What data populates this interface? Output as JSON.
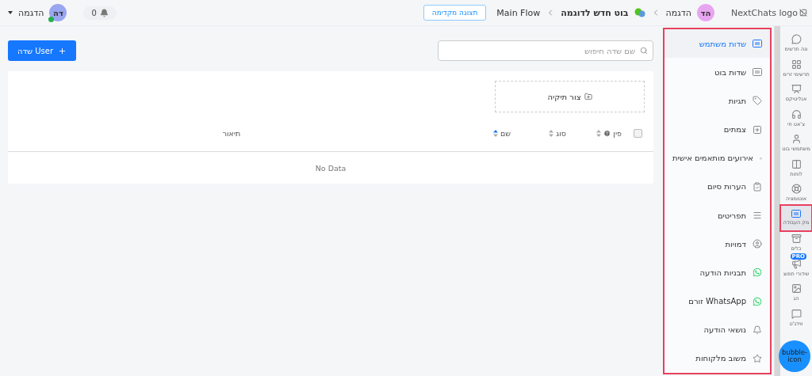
{
  "header": {
    "logo_alt": "NextChats logo",
    "workspace": {
      "initials": "הד",
      "name": "הדגמה"
    },
    "breadcrumbs": [
      {
        "label": "בוט חדש לדוגמה",
        "kind": "bot"
      },
      {
        "label": "Main Flow",
        "kind": "plain"
      }
    ],
    "preview_button": "תצוגה מקדימה",
    "notifications": "0",
    "user": {
      "initials": "דה",
      "name": "הדגמה",
      "online": true
    }
  },
  "rail": [
    {
      "label": "ונה תרשימ",
      "selected": false
    },
    {
      "label": "תרשימי זרימ",
      "selected": false
    },
    {
      "label": "אנליטיקס",
      "selected": false
    },
    {
      "label": "צ'אט חי",
      "selected": false
    },
    {
      "label": "משתמשי בוט",
      "selected": false
    },
    {
      "label": "לוחות",
      "selected": false
    },
    {
      "label": "אוטומציה",
      "selected": false
    },
    {
      "label": "מק העבודה",
      "selected": true
    },
    {
      "label": "כלים",
      "selected": false
    },
    {
      "label": "שידורי תפוצ",
      "selected": false,
      "badge": "PRO"
    },
    {
      "label": "הג",
      "selected": false
    },
    {
      "label": "ווידג'ט",
      "selected": false
    }
  ],
  "submenu": [
    {
      "label": "שדות משתמש",
      "selected": true
    },
    {
      "label": "שדות בוט",
      "selected": false
    },
    {
      "label": "תגיות",
      "selected": false
    },
    {
      "label": "צמתים",
      "selected": false
    },
    {
      "label": "אירועים מותאמים אישית",
      "selected": false
    },
    {
      "label": "הערות סיום",
      "selected": false
    },
    {
      "label": "תפריטים",
      "selected": false
    },
    {
      "label": "דמויות",
      "selected": false
    },
    {
      "label": "תבניות הודעה",
      "selected": false
    },
    {
      "label": "WhatsApp זורם",
      "selected": false
    },
    {
      "label": "נושאי הודעה",
      "selected": false
    },
    {
      "label": "משוב מלקוחות",
      "selected": false
    }
  ],
  "search": {
    "placeholder": "שם שדה חיפוש"
  },
  "add_button": "User שדה",
  "create_folder": "צור תיקיה",
  "table": {
    "select_all": {
      "checked": false
    },
    "columns": [
      {
        "label": "פין",
        "help": true,
        "sortable": true,
        "sorted": false
      },
      {
        "label": "סוג",
        "help": false,
        "sortable": true,
        "sorted": false
      },
      {
        "label": "שם",
        "help": false,
        "sortable": true,
        "sorted": true
      },
      {
        "label": "תיאור",
        "help": false,
        "sortable": false
      }
    ],
    "empty": "No Data"
  },
  "chat_bubble": {
    "alt": "bubble-icon"
  }
}
